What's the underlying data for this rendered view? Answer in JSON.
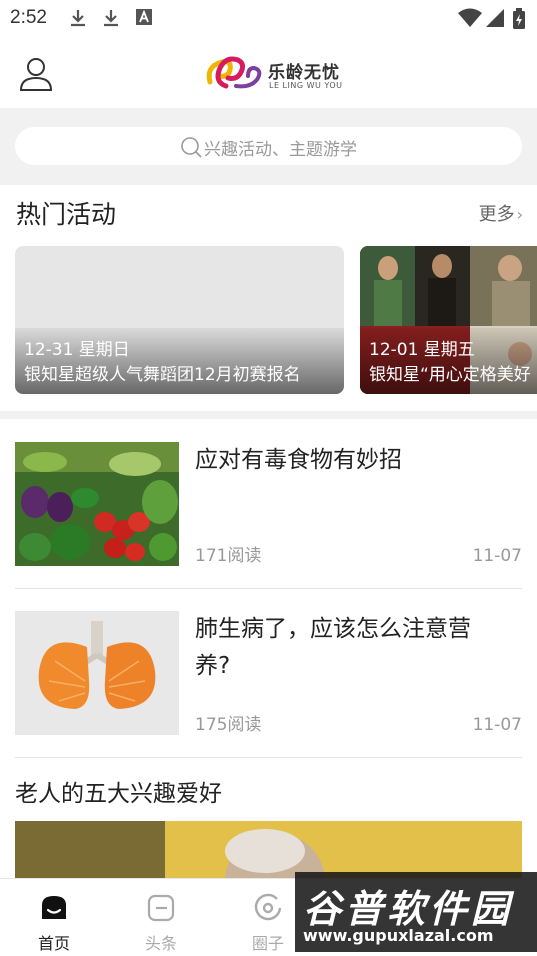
{
  "status_bar": {
    "time": "2:52"
  },
  "header": {
    "logo_text": "乐龄无忧",
    "logo_sub": "LE LING WU YOU"
  },
  "search": {
    "placeholder": "兴趣活动、主题游学"
  },
  "hot_activities": {
    "title": "热门活动",
    "more_label": "更多",
    "cards": [
      {
        "date": "12-31 星期日",
        "title": "银知星超级人气舞蹈团12月初赛报名"
      },
      {
        "date": "12-01 星期五",
        "title": "银知星“用心定格美好"
      }
    ]
  },
  "articles": [
    {
      "title": "应对有毒食物有妙招",
      "reads": "171阅读",
      "date": "11-07"
    },
    {
      "title": "肺生病了，应该怎么注意营养?",
      "reads": "175阅读",
      "date": "11-07"
    }
  ],
  "feature": {
    "title": "老人的五大兴趣爱好"
  },
  "bottom_nav": [
    {
      "label": "首页",
      "active": true
    },
    {
      "label": "头条",
      "active": false
    },
    {
      "label": "圈子",
      "active": false
    }
  ],
  "watermark": {
    "text": "谷普软件园",
    "url": "www.gupuxlazal.com"
  },
  "colors": {
    "accent_bg": "#f1f1f1",
    "text_primary": "#222222",
    "text_muted": "#999999"
  }
}
